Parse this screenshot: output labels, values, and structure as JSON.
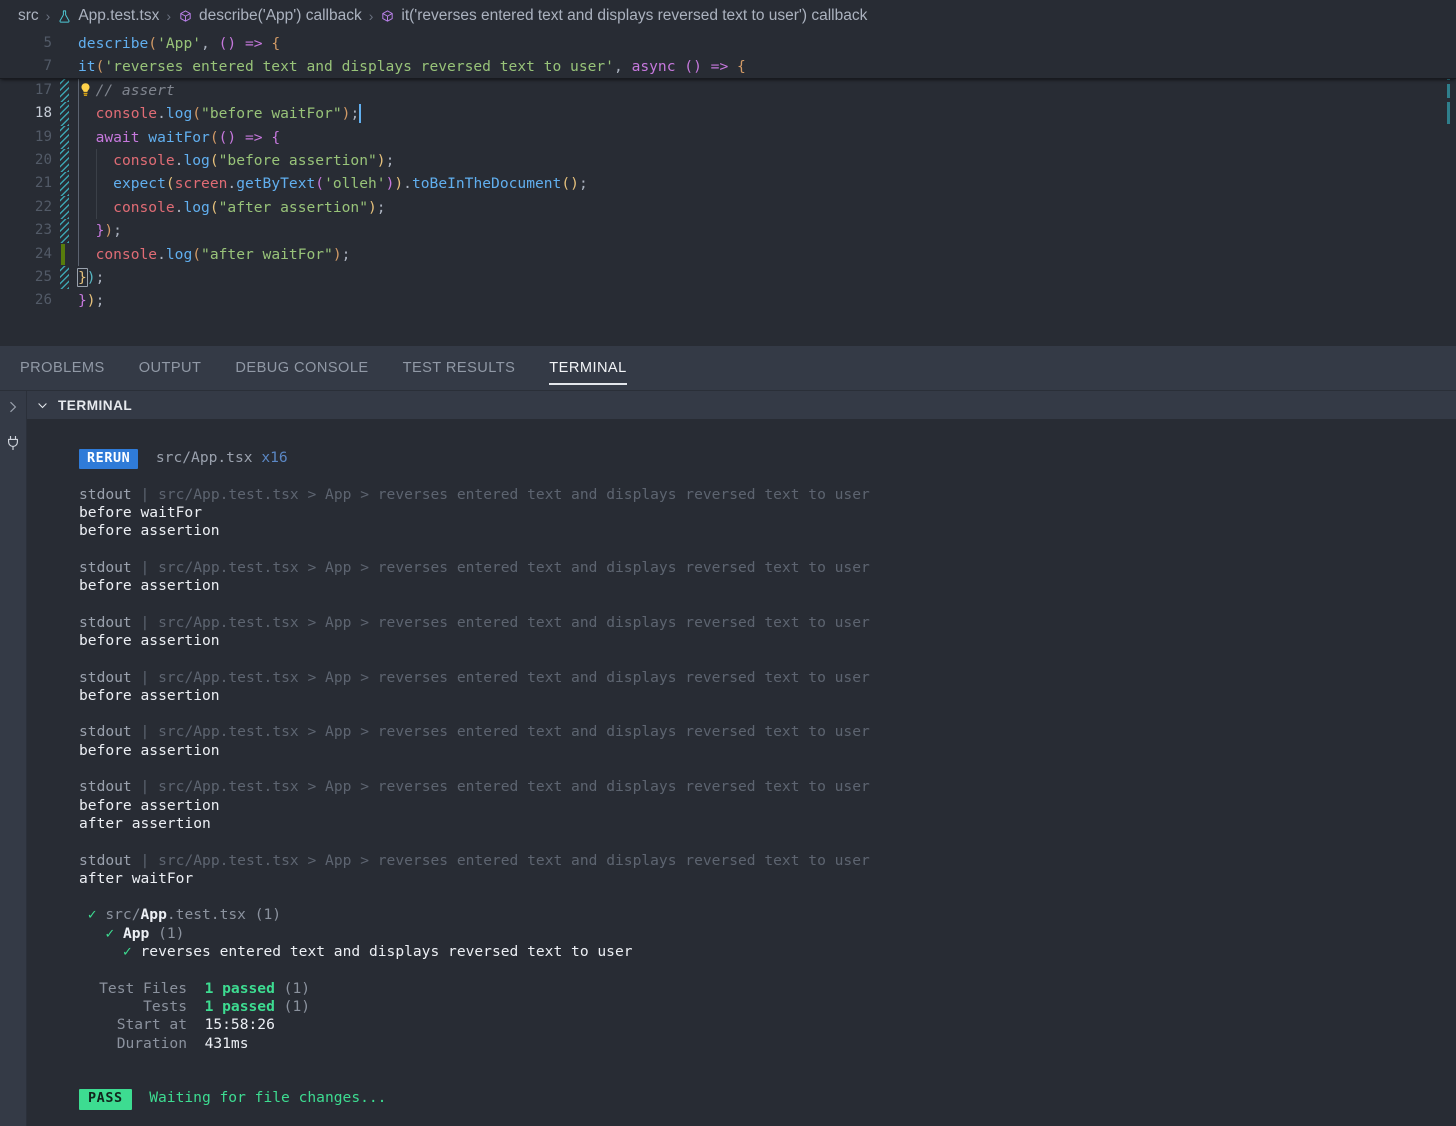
{
  "breadcrumb": {
    "items": [
      {
        "label": "src",
        "icon": ""
      },
      {
        "label": "App.test.tsx",
        "icon": "flask-icon"
      },
      {
        "label": "describe('App') callback",
        "icon": "symbol-method-icon"
      },
      {
        "label": "it('reverses entered text and displays reversed text to user') callback",
        "icon": "symbol-method-icon"
      }
    ],
    "separator": "›"
  },
  "editor": {
    "sticky_lines": [
      {
        "num": "5",
        "segments": [
          {
            "t": "describe",
            "c": "t-fn"
          },
          {
            "t": "(",
            "c": "t-p1"
          },
          {
            "t": "'App'",
            "c": "t-str"
          },
          {
            "t": ", ",
            "c": "t-pun"
          },
          {
            "t": "(",
            "c": "t-p2"
          },
          {
            "t": ")",
            "c": "t-p2"
          },
          {
            "t": " ",
            "c": "t-pun"
          },
          {
            "t": "=>",
            "c": "t-op"
          },
          {
            "t": " ",
            "c": "t-pun"
          },
          {
            "t": "{",
            "c": "t-p1"
          }
        ],
        "indent": 0
      },
      {
        "num": "7",
        "segments": [
          {
            "t": "it",
            "c": "t-fn"
          },
          {
            "t": "(",
            "c": "t-p1"
          },
          {
            "t": "'reverses entered text and displays reversed text to user'",
            "c": "t-str"
          },
          {
            "t": ", ",
            "c": "t-pun"
          },
          {
            "t": "async ",
            "c": "t-kw"
          },
          {
            "t": "(",
            "c": "t-p2"
          },
          {
            "t": ")",
            "c": "t-p2"
          },
          {
            "t": " ",
            "c": "t-pun"
          },
          {
            "t": "=>",
            "c": "t-op"
          },
          {
            "t": " ",
            "c": "t-pun"
          },
          {
            "t": "{",
            "c": "t-p1"
          }
        ],
        "indent": 0
      }
    ],
    "lines": [
      {
        "num": "17",
        "active": false,
        "stripe": true,
        "green": false,
        "bulb": true,
        "segments": [
          {
            "t": "  // assert",
            "c": "t-com"
          }
        ]
      },
      {
        "num": "18",
        "active": true,
        "stripe": true,
        "green": false,
        "caret_after": true,
        "segments": [
          {
            "t": "  ",
            "c": "t-pun"
          },
          {
            "t": "console",
            "c": "t-var"
          },
          {
            "t": ".",
            "c": "t-pun"
          },
          {
            "t": "log",
            "c": "t-fn"
          },
          {
            "t": "(",
            "c": "t-p1"
          },
          {
            "t": "\"before waitFor\"",
            "c": "t-str"
          },
          {
            "t": ")",
            "c": "t-p1"
          },
          {
            "t": ";",
            "c": "t-pun"
          }
        ]
      },
      {
        "num": "19",
        "active": false,
        "stripe": true,
        "green": false,
        "segments": [
          {
            "t": "  ",
            "c": "t-pun"
          },
          {
            "t": "await ",
            "c": "t-kw"
          },
          {
            "t": "waitFor",
            "c": "t-fn"
          },
          {
            "t": "(",
            "c": "t-p1"
          },
          {
            "t": "(",
            "c": "t-p2"
          },
          {
            "t": ")",
            "c": "t-p2"
          },
          {
            "t": " ",
            "c": "t-pun"
          },
          {
            "t": "=>",
            "c": "t-op"
          },
          {
            "t": " ",
            "c": "t-pun"
          },
          {
            "t": "{",
            "c": "t-p2"
          }
        ]
      },
      {
        "num": "20",
        "active": false,
        "stripe": true,
        "green": false,
        "segments": [
          {
            "t": "    ",
            "c": "t-pun"
          },
          {
            "t": "console",
            "c": "t-var"
          },
          {
            "t": ".",
            "c": "t-pun"
          },
          {
            "t": "log",
            "c": "t-fn"
          },
          {
            "t": "(",
            "c": "t-y"
          },
          {
            "t": "\"before assertion\"",
            "c": "t-str"
          },
          {
            "t": ")",
            "c": "t-y"
          },
          {
            "t": ";",
            "c": "t-pun"
          }
        ]
      },
      {
        "num": "21",
        "active": false,
        "stripe": true,
        "green": false,
        "segments": [
          {
            "t": "    ",
            "c": "t-pun"
          },
          {
            "t": "expect",
            "c": "t-fn"
          },
          {
            "t": "(",
            "c": "t-y"
          },
          {
            "t": "screen",
            "c": "t-var"
          },
          {
            "t": ".",
            "c": "t-pun"
          },
          {
            "t": "getByText",
            "c": "t-fn"
          },
          {
            "t": "(",
            "c": "t-p2"
          },
          {
            "t": "'olleh'",
            "c": "t-str"
          },
          {
            "t": ")",
            "c": "t-p2"
          },
          {
            "t": ")",
            "c": "t-y"
          },
          {
            "t": ".",
            "c": "t-pun"
          },
          {
            "t": "toBeInTheDocument",
            "c": "t-fn"
          },
          {
            "t": "(",
            "c": "t-y"
          },
          {
            "t": ")",
            "c": "t-y"
          },
          {
            "t": ";",
            "c": "t-pun"
          }
        ]
      },
      {
        "num": "22",
        "active": false,
        "stripe": true,
        "green": false,
        "segments": [
          {
            "t": "    ",
            "c": "t-pun"
          },
          {
            "t": "console",
            "c": "t-var"
          },
          {
            "t": ".",
            "c": "t-pun"
          },
          {
            "t": "log",
            "c": "t-fn"
          },
          {
            "t": "(",
            "c": "t-y"
          },
          {
            "t": "\"after assertion\"",
            "c": "t-str"
          },
          {
            "t": ")",
            "c": "t-y"
          },
          {
            "t": ";",
            "c": "t-pun"
          }
        ]
      },
      {
        "num": "23",
        "active": false,
        "stripe": true,
        "green": false,
        "segments": [
          {
            "t": "  ",
            "c": "t-pun"
          },
          {
            "t": "}",
            "c": "t-p2"
          },
          {
            "t": ")",
            "c": "t-p1"
          },
          {
            "t": ";",
            "c": "t-pun"
          }
        ]
      },
      {
        "num": "24",
        "active": false,
        "stripe": false,
        "green": true,
        "segments": [
          {
            "t": "  ",
            "c": "t-pun"
          },
          {
            "t": "console",
            "c": "t-var"
          },
          {
            "t": ".",
            "c": "t-pun"
          },
          {
            "t": "log",
            "c": "t-fn"
          },
          {
            "t": "(",
            "c": "t-p1"
          },
          {
            "t": "\"after waitFor\"",
            "c": "t-str"
          },
          {
            "t": ")",
            "c": "t-p1"
          },
          {
            "t": ";",
            "c": "t-pun"
          }
        ]
      },
      {
        "num": "25",
        "active": false,
        "stripe": true,
        "green": false,
        "bracket_match": true,
        "segments": [
          {
            "t": "}",
            "c": "t-y"
          },
          {
            "t": ")",
            "c": "t-p3"
          },
          {
            "t": ";",
            "c": "t-pun"
          }
        ]
      },
      {
        "num": "26",
        "active": false,
        "stripe": false,
        "green": false,
        "segments": [
          {
            "t": "}",
            "c": "t-p2"
          },
          {
            "t": ")",
            "c": "t-y"
          },
          {
            "t": ";",
            "c": "t-pun"
          }
        ]
      }
    ]
  },
  "panel": {
    "tabs": [
      {
        "label": "PROBLEMS",
        "active": false
      },
      {
        "label": "OUTPUT",
        "active": false
      },
      {
        "label": "DEBUG CONSOLE",
        "active": false
      },
      {
        "label": "TEST RESULTS",
        "active": false
      },
      {
        "label": "TERMINAL",
        "active": true
      }
    ],
    "terminal_header": "TERMINAL",
    "sidebar_icons": [
      "chevron-right-icon",
      "plug-icon"
    ]
  },
  "terminal": {
    "rerun": {
      "badge": "RERUN",
      "file": "src/App.tsx",
      "count": "x16"
    },
    "stdout_label": "stdout",
    "stdout_pipe": "|",
    "stdout_context": "src/App.test.tsx > App > reverses entered text and displays reversed text to user",
    "groups": [
      {
        "lines": [
          "before waitFor",
          "before assertion"
        ]
      },
      {
        "lines": [
          "before assertion"
        ]
      },
      {
        "lines": [
          "before assertion"
        ]
      },
      {
        "lines": [
          "before assertion"
        ]
      },
      {
        "lines": [
          "before assertion"
        ]
      },
      {
        "lines": [
          "before assertion",
          "after assertion"
        ]
      },
      {
        "lines": [
          "after waitFor"
        ]
      }
    ],
    "results": {
      "check": "✓",
      "file_prefix": "src/",
      "file_name": "App",
      "file_suffix": ".test.tsx",
      "file_count": "(1)",
      "suite_name": "App",
      "suite_count": "(1)",
      "test_name": "reverses entered text and displays reversed text to user"
    },
    "summary": [
      {
        "label": "Test Files",
        "value": "1 passed",
        "extra": "(1)",
        "value_style": "green"
      },
      {
        "label": "Tests",
        "value": "1 passed",
        "extra": "(1)",
        "value_style": "green"
      },
      {
        "label": "Start at",
        "value": "15:58:26",
        "extra": "",
        "value_style": "white"
      },
      {
        "label": "Duration",
        "value": "431ms",
        "extra": "",
        "value_style": "white"
      }
    ],
    "footer": {
      "badge": "PASS",
      "message": "Waiting for file changes..."
    }
  },
  "colors": {
    "editor_bg": "#282c34",
    "panel_bg": "#21252b",
    "tabbar_bg": "#343a46",
    "accent_blue": "#2f7bd8",
    "accent_green": "#3ddc91",
    "gutter_teal": "#3fb9c6",
    "gutter_green": "#587c0c"
  }
}
